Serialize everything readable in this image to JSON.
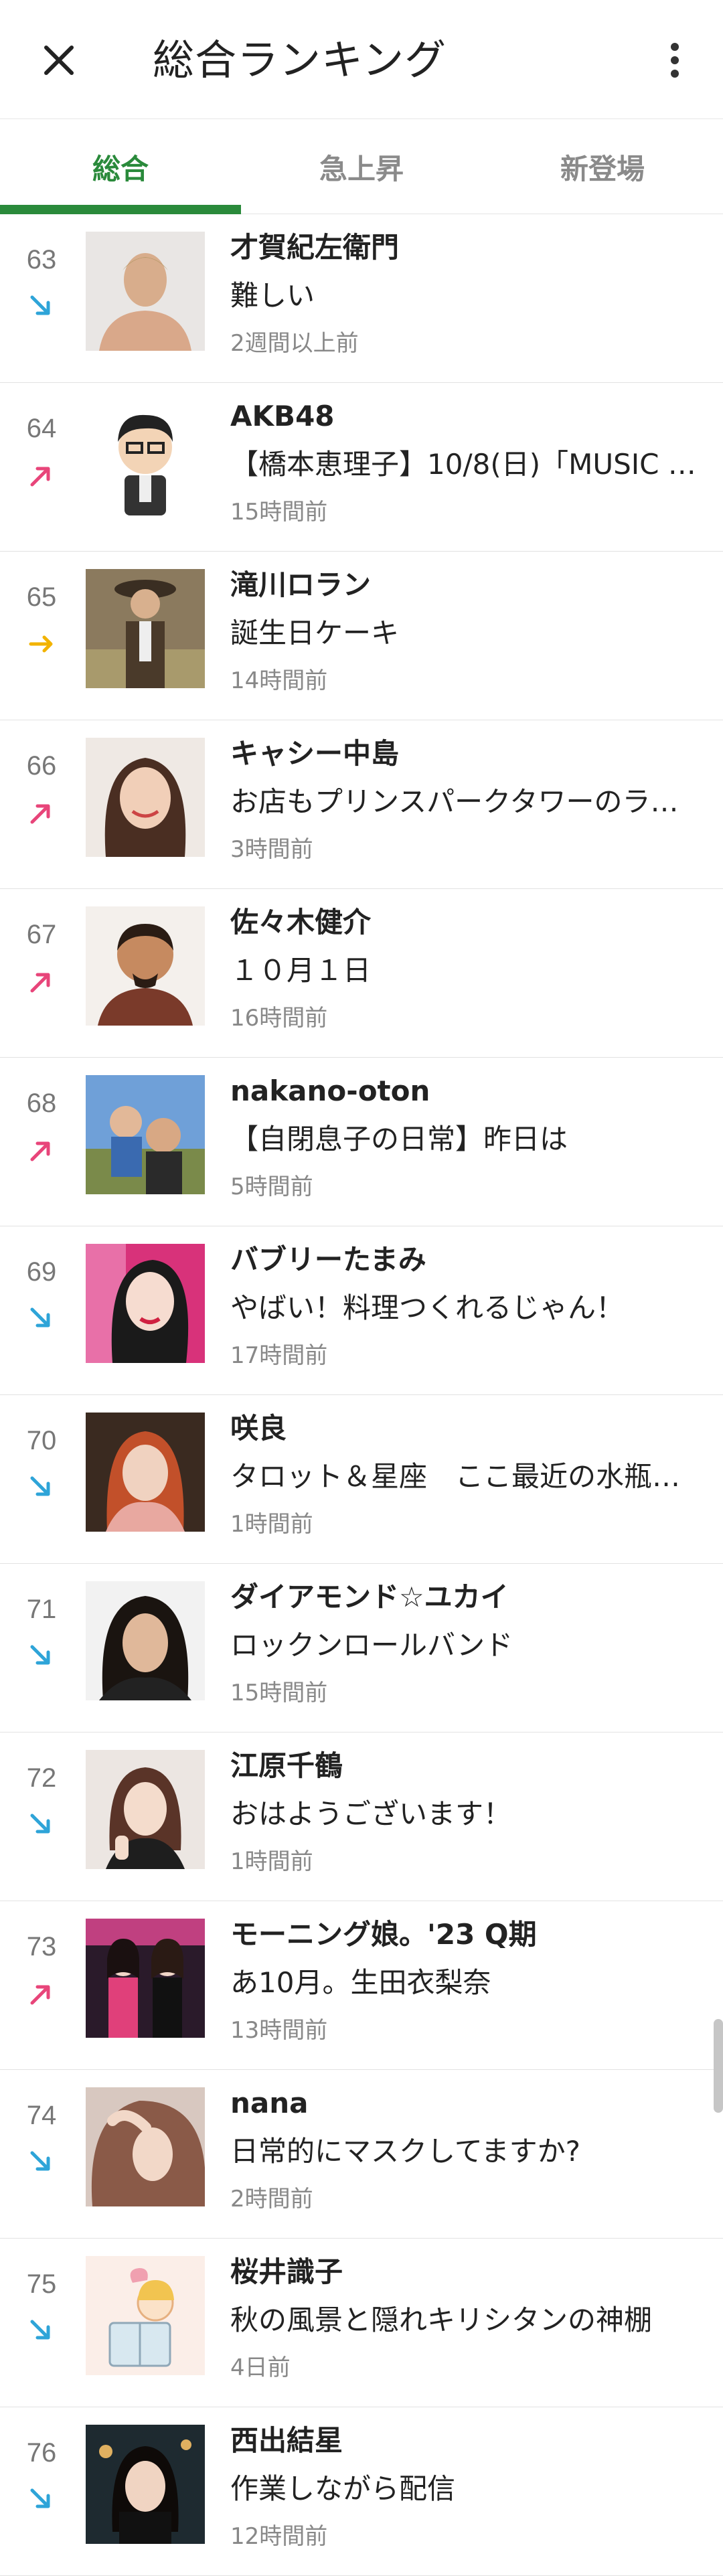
{
  "appbar": {
    "title": "総合ランキング",
    "close_icon": "close-icon",
    "more_icon": "more-vertical-icon"
  },
  "tabs": [
    {
      "label": "総合",
      "active": true
    },
    {
      "label": "急上昇",
      "active": false
    },
    {
      "label": "新登場",
      "active": false
    }
  ],
  "colors": {
    "accent_green": "#2a8a3b",
    "trend_up": "#e8457a",
    "trend_down": "#2ea4d8",
    "trend_flat": "#f2b300"
  },
  "rows": [
    {
      "rank": "63",
      "trend": "down",
      "name": "才賀紀左衛門",
      "post": "難しい",
      "time": "2週間以上前"
    },
    {
      "rank": "64",
      "trend": "up",
      "name": "AKB48",
      "post": "【橋本恵理子】10/8(日)「MUSIC …",
      "time": "15時間前"
    },
    {
      "rank": "65",
      "trend": "flat",
      "name": "滝川ロラン",
      "post": "誕生日ケーキ",
      "time": "14時間前"
    },
    {
      "rank": "66",
      "trend": "up",
      "name": "キャシー中島",
      "post": "お店もプリンスパークタワーのラ…",
      "time": "3時間前"
    },
    {
      "rank": "67",
      "trend": "up",
      "name": "佐々木健介",
      "post": "１０月１日",
      "time": "16時間前"
    },
    {
      "rank": "68",
      "trend": "up",
      "name": "nakano-oton",
      "post": "【自閉息子の日常】昨日は",
      "time": "5時間前"
    },
    {
      "rank": "69",
      "trend": "down",
      "name": "バブリーたまみ",
      "post": "やばい！料理つくれるじゃん！",
      "time": "17時間前"
    },
    {
      "rank": "70",
      "trend": "down",
      "name": "咲良",
      "post": "タロット＆星座　ここ最近の水瓶…",
      "time": "1時間前"
    },
    {
      "rank": "71",
      "trend": "down",
      "name": "ダイアモンド☆ユカイ",
      "post": "ロックンロールバンド",
      "time": "15時間前"
    },
    {
      "rank": "72",
      "trend": "down",
      "name": "江原千鶴",
      "post": "おはようございます！",
      "time": "1時間前"
    },
    {
      "rank": "73",
      "trend": "up",
      "name": "モーニング娘。'23 Q期",
      "post": "あ10月。生田衣梨奈",
      "time": "13時間前"
    },
    {
      "rank": "74",
      "trend": "down",
      "name": "nana",
      "post": "日常的にマスクしてますか?",
      "time": "2時間前"
    },
    {
      "rank": "75",
      "trend": "down",
      "name": "桜井識子",
      "post": "秋の風景と隠れキリシタンの神棚",
      "time": "4日前"
    },
    {
      "rank": "76",
      "trend": "down",
      "name": "西出結星",
      "post": "作業しながら配信",
      "time": "12時間前"
    }
  ]
}
